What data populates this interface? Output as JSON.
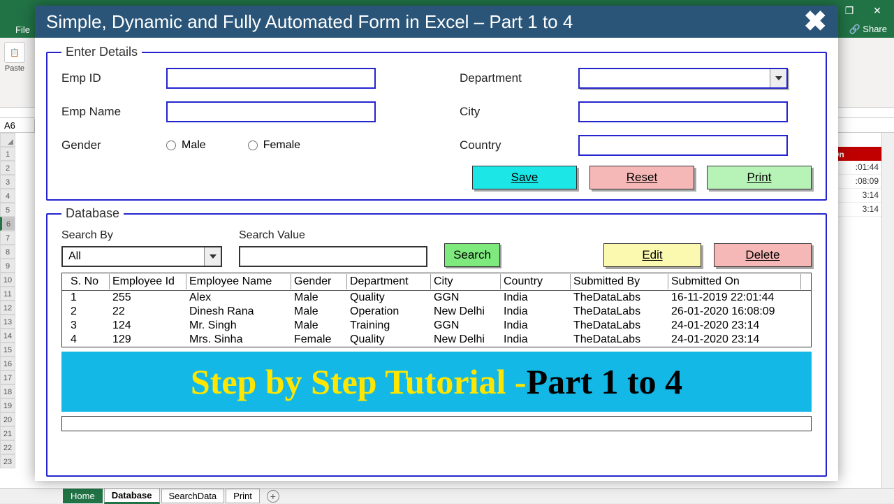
{
  "excel": {
    "file_tab": "File",
    "share": "Share",
    "paste": "Paste",
    "name_box": "A6",
    "bg_col_header": "On",
    "bg_cells": [
      ":01:44",
      ":08:09",
      "3:14",
      "3:14"
    ],
    "sheets": {
      "home": "Home",
      "active": "Database",
      "search": "SearchData",
      "print": "Print"
    }
  },
  "dialog": {
    "title": "Simple, Dynamic and Fully Automated Form in Excel – Part 1 to 4"
  },
  "form": {
    "legend": "Enter Details",
    "emp_id": "Emp ID",
    "emp_name": "Emp Name",
    "gender": "Gender",
    "male": "Male",
    "female": "Female",
    "department": "Department",
    "city": "City",
    "country": "Country",
    "save": "Save",
    "reset": "Reset",
    "print": "Print"
  },
  "db": {
    "legend": "Database",
    "search_by": "Search By",
    "search_by_value": "All",
    "search_value": "Search Value",
    "search": "Search",
    "edit": "Edit",
    "delete": "Delete",
    "headers": [
      "S. No",
      "Employee Id",
      "Employee Name",
      "Gender",
      "Department",
      "City",
      "Country",
      "Submitted By",
      "Submitted On"
    ],
    "rows": [
      [
        "1",
        "255",
        "Alex",
        "Male",
        "Quality",
        "GGN",
        "India",
        "TheDataLabs",
        "16-11-2019 22:01:44"
      ],
      [
        "2",
        "22",
        "Dinesh Rana",
        "Male",
        "Operation",
        "New Delhi",
        "India",
        "TheDataLabs",
        "26-01-2020 16:08:09"
      ],
      [
        "3",
        "124",
        "Mr. Singh",
        "Male",
        "Training",
        "GGN",
        "India",
        "TheDataLabs",
        "24-01-2020 23:14"
      ],
      [
        "4",
        "129",
        "Mrs. Sinha",
        "Female",
        "Quality",
        "New Delhi",
        "India",
        "TheDataLabs",
        "24-01-2020 23:14"
      ]
    ]
  },
  "banner": {
    "part1": "Step by Step Tutorial - ",
    "part2": "Part 1 to 4"
  }
}
